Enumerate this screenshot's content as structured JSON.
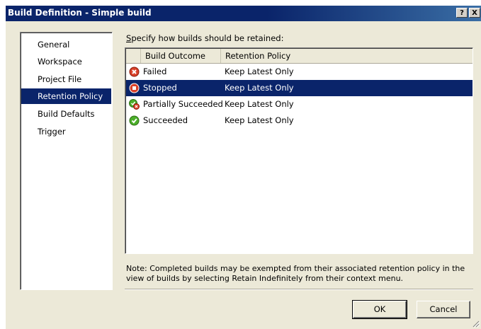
{
  "window": {
    "title": "Build Definition - Simple build",
    "help_label": "?",
    "close_label": "X"
  },
  "nav": {
    "items": [
      {
        "label": "General",
        "selected": false
      },
      {
        "label": "Workspace",
        "selected": false
      },
      {
        "label": "Project File",
        "selected": false
      },
      {
        "label": "Retention Policy",
        "selected": true
      },
      {
        "label": "Build Defaults",
        "selected": false
      },
      {
        "label": "Trigger",
        "selected": false
      }
    ]
  },
  "retention": {
    "label_underlined": "S",
    "label_rest": "pecify how builds should be retained:",
    "columns": {
      "outcome": "Build Outcome",
      "policy": "Retention Policy"
    },
    "rows": [
      {
        "outcome": "Failed",
        "policy": "Keep Latest Only",
        "icon": "failed-icon",
        "selected": false
      },
      {
        "outcome": "Stopped",
        "policy": "Keep Latest Only",
        "icon": "stopped-icon",
        "selected": true
      },
      {
        "outcome": "Partially Succeeded",
        "policy": "Keep Latest Only",
        "icon": "partially-succeeded-icon",
        "selected": false
      },
      {
        "outcome": "Succeeded",
        "policy": "Keep Latest Only",
        "icon": "succeeded-icon",
        "selected": false
      }
    ],
    "note": "Note: Completed builds may be exempted from their associated retention policy in the view of builds by selecting Retain Indefinitely from their context menu."
  },
  "buttons": {
    "ok": "OK",
    "cancel": "Cancel"
  },
  "colors": {
    "selection": "#0a246a",
    "failed": "#d9412a",
    "succeeded": "#4caf2a",
    "face": "#ece9d8"
  }
}
